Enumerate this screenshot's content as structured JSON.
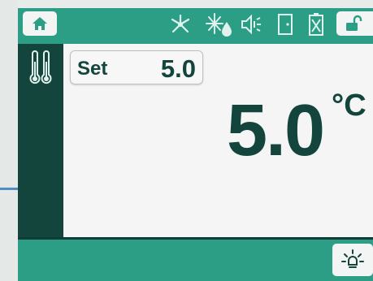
{
  "header": {
    "buttons": [
      {
        "icon": "home-icon"
      },
      {
        "icon": "unlock-icon"
      }
    ],
    "status_icons": [
      "fan-icon",
      "defrost-icon",
      "alarm-mute-icon",
      "door-icon",
      "battery-warning-icon"
    ]
  },
  "sidebar": {
    "icon": "thermometers-icon"
  },
  "setpoint": {
    "label": "Set",
    "value": "5.0"
  },
  "temperature": {
    "value": "5.0",
    "unit": "°C"
  },
  "footer": {
    "light_button_icon": "light-icon"
  },
  "colors": {
    "bar": "#2c9e86",
    "dark": "#14453d",
    "panel": "#f4f5f4",
    "icon": "#dff2ee"
  }
}
